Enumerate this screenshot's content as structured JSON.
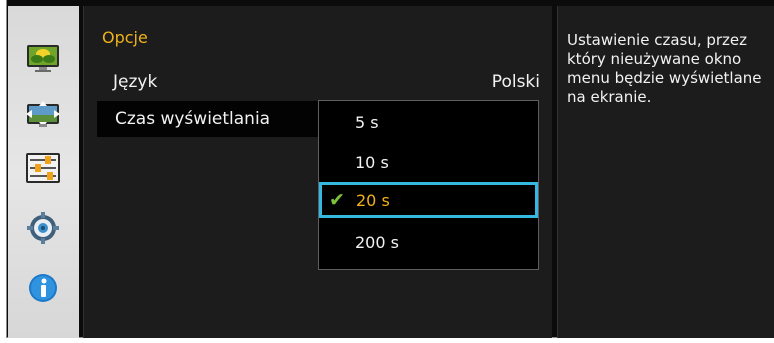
{
  "colors": {
    "accent": "#f0b21a",
    "highlight_border": "#34b7e0",
    "check": "#7ec23a"
  },
  "sidebar": {
    "items": [
      {
        "icon": "picture-icon"
      },
      {
        "icon": "display-position-icon"
      },
      {
        "icon": "options-sliders-icon"
      },
      {
        "icon": "gear-icon"
      },
      {
        "icon": "info-icon"
      }
    ]
  },
  "menu": {
    "title": "Opcje",
    "rows": [
      {
        "label": "Język",
        "value": "Polski"
      },
      {
        "label": "Czas wyświetlania",
        "value": ""
      }
    ]
  },
  "dropdown": {
    "options": [
      {
        "label": "5 s",
        "selected": false
      },
      {
        "label": "10 s",
        "selected": false
      },
      {
        "label": "20 s",
        "selected": true
      },
      {
        "label": "200 s",
        "selected": false
      }
    ]
  },
  "help": {
    "text": "Ustawienie czasu, przez który nieużywane okno menu będzie wyświetlane na ekranie."
  }
}
